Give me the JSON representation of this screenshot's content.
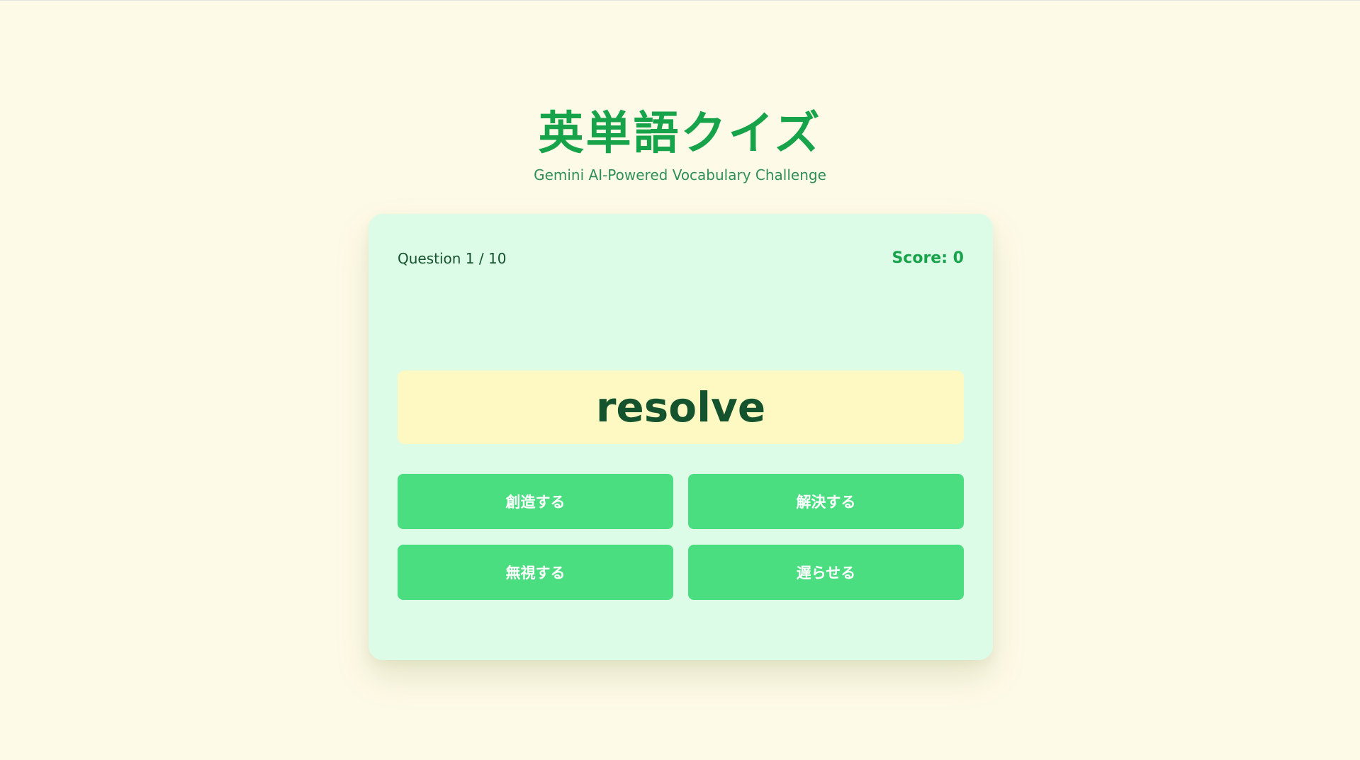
{
  "header": {
    "title": "英単語クイズ",
    "subtitle": "Gemini AI-Powered Vocabulary Challenge"
  },
  "quiz": {
    "progress": "Question 1 / 10",
    "score": "Score: 0",
    "word": "resolve",
    "options": [
      "創造する",
      "解決する",
      "無視する",
      "遅らせる"
    ]
  },
  "colors": {
    "background": "#fefae8",
    "card": "#dcfce7",
    "accent": "#16a34a",
    "word_box": "#fef9c3",
    "option_button": "#4ade80",
    "text_dark": "#14532d"
  }
}
